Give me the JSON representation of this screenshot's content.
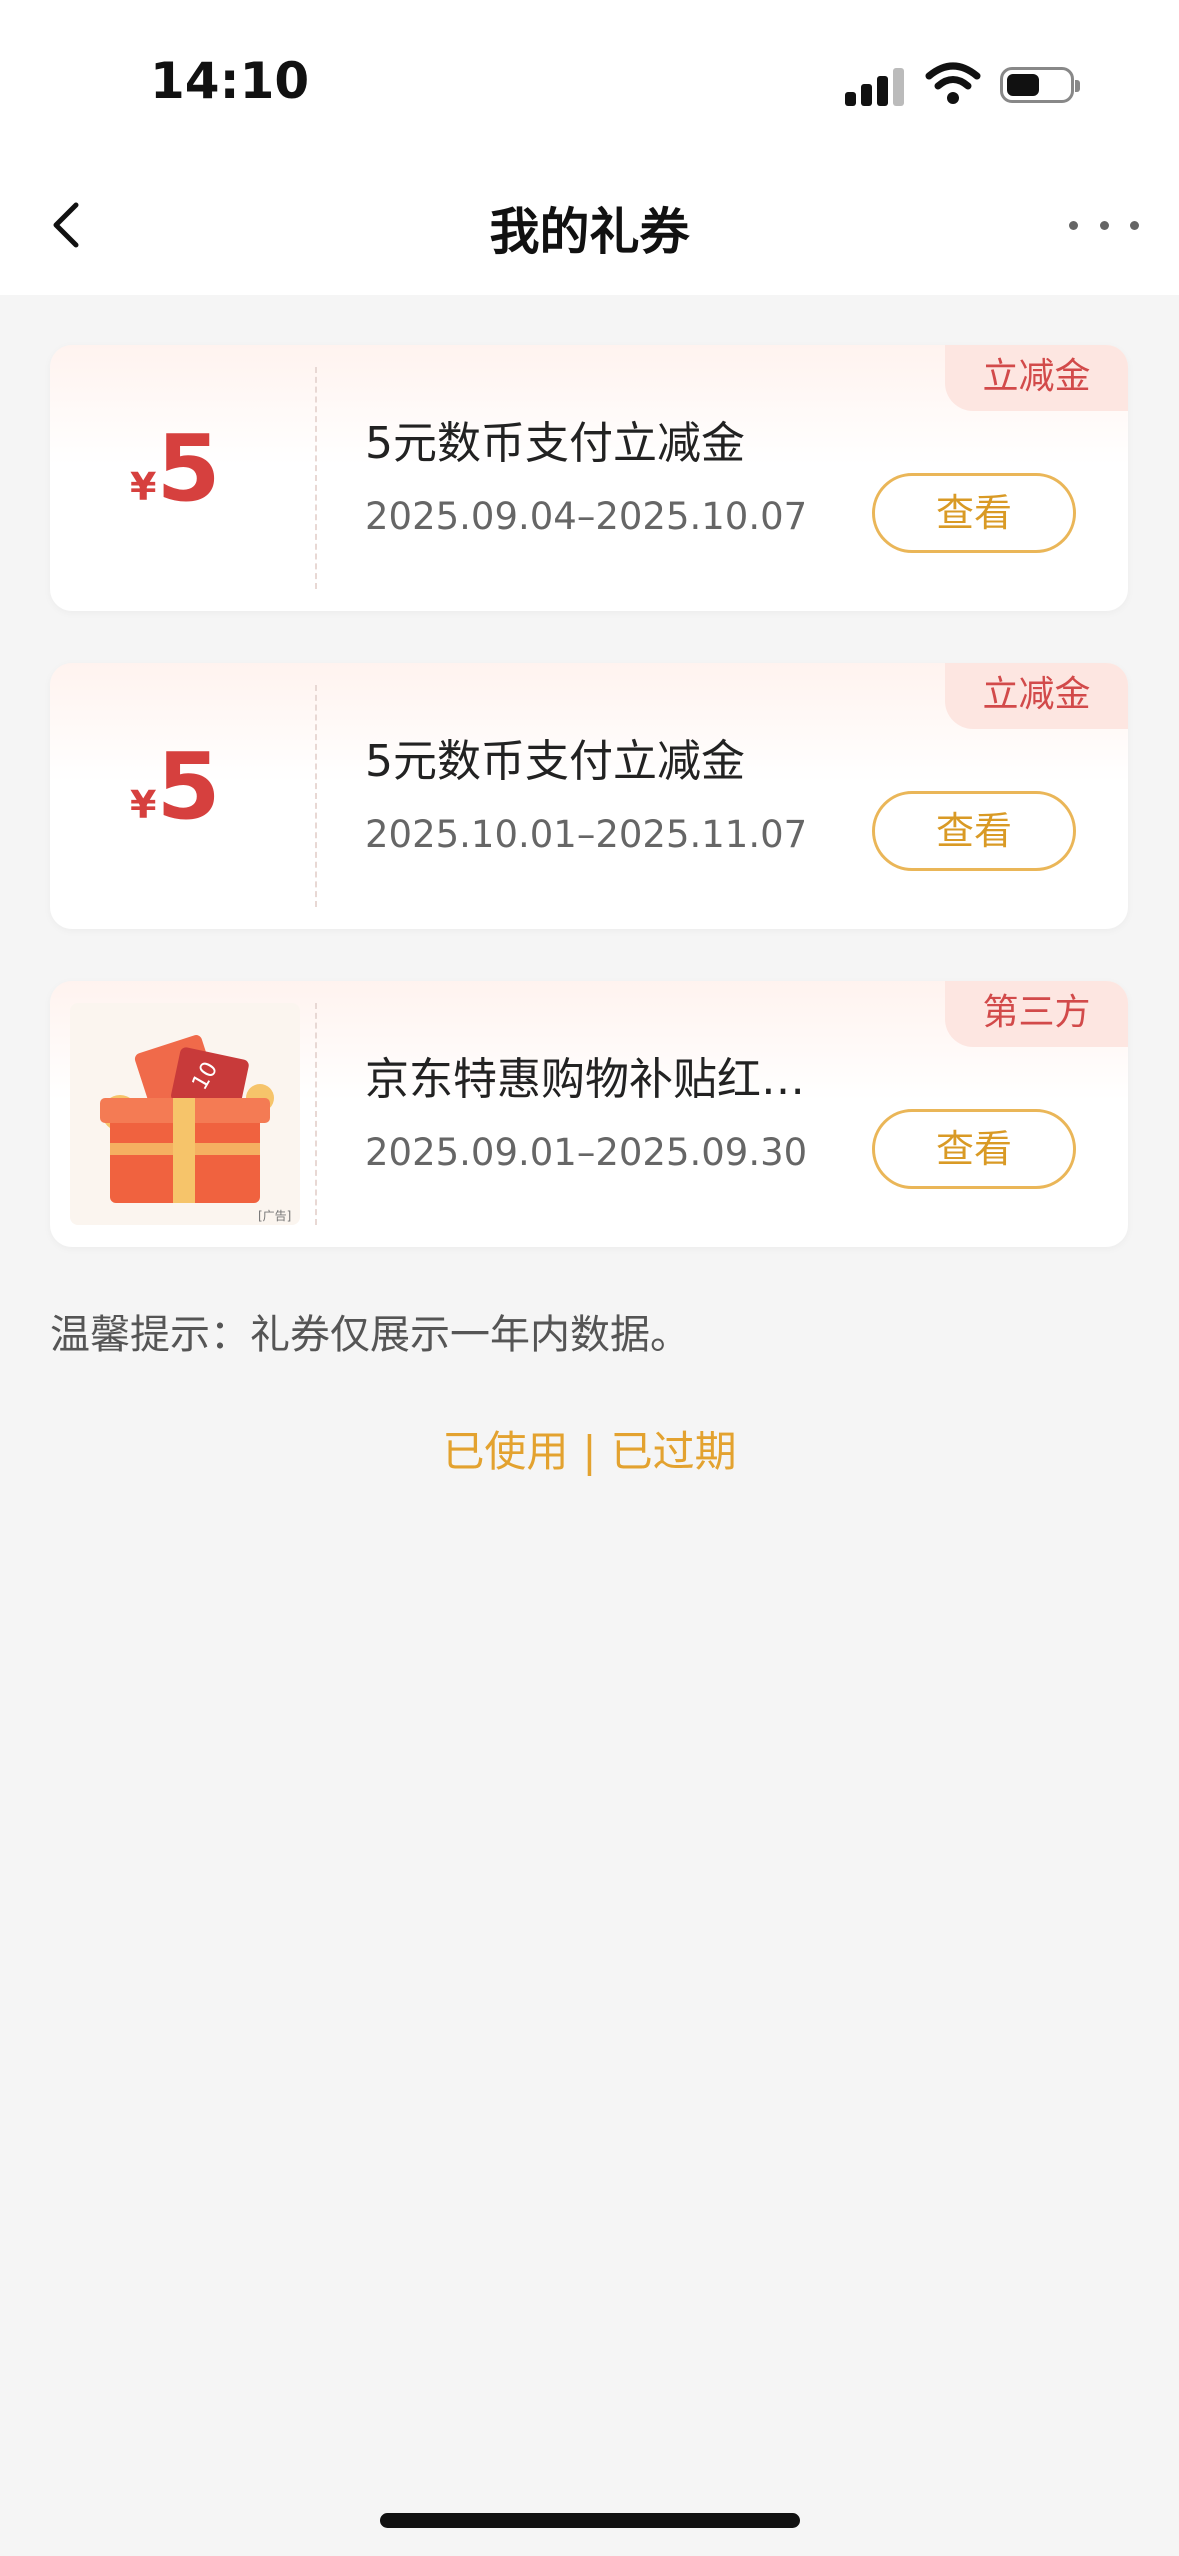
{
  "status_bar": {
    "time": "14:10"
  },
  "nav": {
    "title": "我的礼券"
  },
  "coupons": [
    {
      "tag": "立减金",
      "currency": "¥",
      "amount": "5",
      "title": "5元数币支付立减金",
      "date_range": "2025.09.04–2025.10.07",
      "button": "查看"
    },
    {
      "tag": "立减金",
      "currency": "¥",
      "amount": "5",
      "title": "5元数币支付立减金",
      "date_range": "2025.10.01–2025.11.07",
      "button": "查看"
    },
    {
      "tag": "第三方",
      "title": "京东特惠购物补贴红…",
      "date_range": "2025.09.01–2025.09.30",
      "button": "查看",
      "ad_mark": "[广告]"
    }
  ],
  "tip": "温馨提示：礼券仅展示一年内数据。",
  "footer": {
    "used": "已使用",
    "separator": "|",
    "expired": "已过期"
  },
  "colors": {
    "accent_red": "#d6403e",
    "accent_gold": "#e3a22f",
    "background": "#f5f5f5"
  }
}
